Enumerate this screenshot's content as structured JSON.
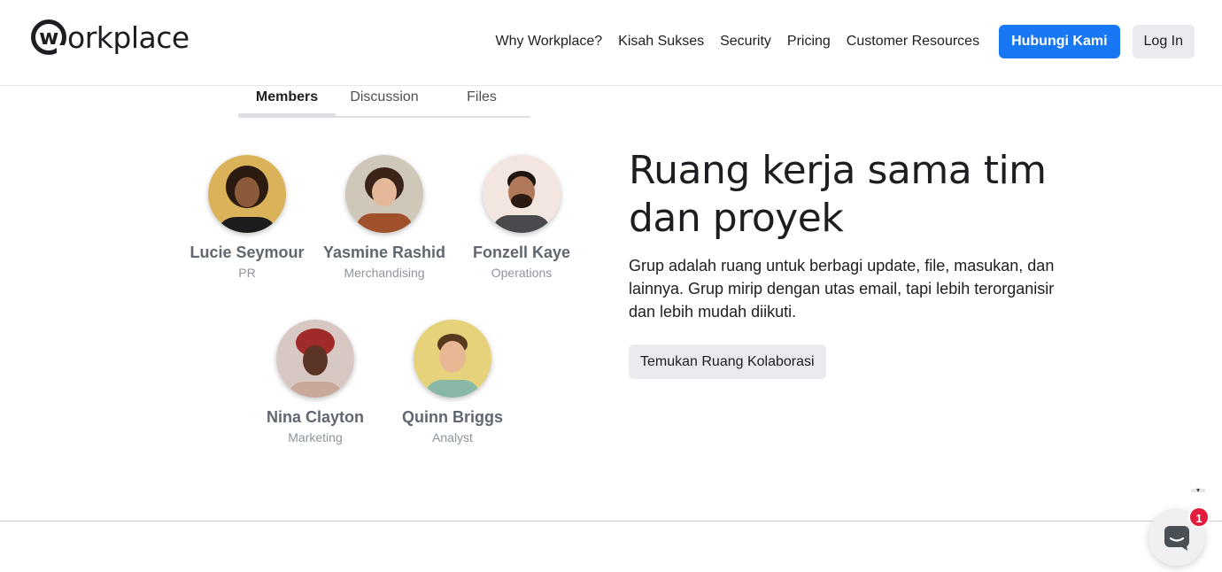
{
  "header": {
    "logo_text": "orkplace",
    "logo_mark": "w",
    "nav": [
      "Why Workplace?",
      "Kisah Sukses",
      "Security",
      "Pricing",
      "Customer Resources"
    ],
    "primary_button": "Hubungi Kami",
    "login_button": "Log In"
  },
  "tabs": [
    "Members",
    "Discussion",
    "Files"
  ],
  "members": [
    {
      "name": "Lucie Seymour",
      "role": "PR"
    },
    {
      "name": "Yasmine Rashid",
      "role": "Merchandising"
    },
    {
      "name": "Fonzell Kaye",
      "role": "Operations"
    },
    {
      "name": "Nina Clayton",
      "role": "Marketing"
    },
    {
      "name": "Quinn Briggs",
      "role": "Analyst"
    }
  ],
  "hero": {
    "title": "Ruang kerja sama tim dan proyek",
    "description": "Grup adalah ruang untuk berbagi update, file, masukan, dan lainnya. Grup mirip dengan utas email, tapi lebih terorganisir dan lebih mudah diikuti.",
    "cta": "Temukan Ruang Kolaborasi"
  },
  "chat": {
    "badge_count": "1",
    "icon": "chat-bubble-icon"
  },
  "colors": {
    "accent": "#1877f2",
    "badge": "#e41e3f",
    "secondary_button": "#e9ebee"
  }
}
